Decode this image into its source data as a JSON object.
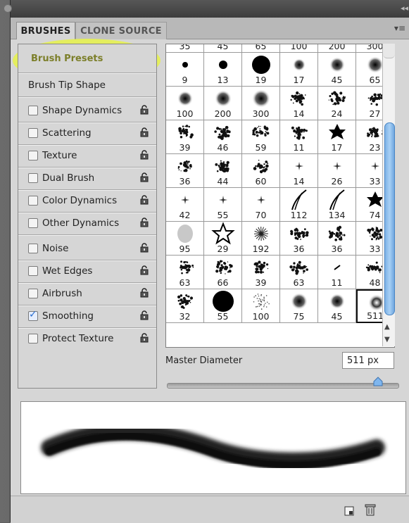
{
  "tabs": {
    "brushes": "BRUSHES",
    "clone_source": "CLONE SOURCE"
  },
  "panel_menu_icon": "panel-menu-icon",
  "left_list": {
    "brush_presets": "Brush Presets",
    "brush_tip_shape": "Brush Tip Shape",
    "items": [
      {
        "label": "Shape Dynamics",
        "checked": false
      },
      {
        "label": "Scattering",
        "checked": false
      },
      {
        "label": "Texture",
        "checked": false
      },
      {
        "label": "Dual Brush",
        "checked": false
      },
      {
        "label": "Color Dynamics",
        "checked": false
      },
      {
        "label": "Other Dynamics",
        "checked": false
      },
      {
        "label": "Noise",
        "checked": false
      },
      {
        "label": "Wet Edges",
        "checked": false
      },
      {
        "label": "Airbrush",
        "checked": false
      },
      {
        "label": "Smoothing",
        "checked": true
      },
      {
        "label": "Protect Texture",
        "checked": false
      }
    ]
  },
  "brush_grid": {
    "rows": [
      [
        "35",
        "45",
        "65",
        "100",
        "200",
        "300"
      ],
      [
        "9",
        "13",
        "19",
        "17",
        "45",
        "65"
      ],
      [
        "100",
        "200",
        "300",
        "14",
        "24",
        "27"
      ],
      [
        "39",
        "46",
        "59",
        "11",
        "17",
        "23"
      ],
      [
        "36",
        "44",
        "60",
        "14",
        "26",
        "33"
      ],
      [
        "42",
        "55",
        "70",
        "112",
        "134",
        "74"
      ],
      [
        "95",
        "29",
        "192",
        "36",
        "36",
        "33"
      ],
      [
        "63",
        "66",
        "39",
        "63",
        "11",
        "48"
      ],
      [
        "32",
        "55",
        "100",
        "75",
        "45",
        "511"
      ]
    ],
    "selected_value": "511"
  },
  "master_diameter": {
    "label": "Master Diameter",
    "value": "511 px"
  },
  "colors": {
    "highlight": "#e8f53c",
    "preset_text": "#7c7f2a",
    "scroll_thumb": "#7db2e6"
  }
}
